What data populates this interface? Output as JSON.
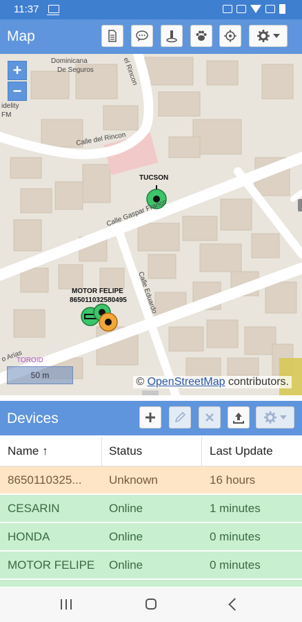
{
  "status_bar": {
    "time": "11:37"
  },
  "map_panel": {
    "title": "Map",
    "toolbar_icons": [
      "report-icon",
      "chat-icon",
      "geofence-icon",
      "paw-icon",
      "locate-icon",
      "gear-icon"
    ],
    "zoom_in": "+",
    "zoom_out": "−",
    "scale": "50 m",
    "attribution_link": "OpenStreetMap",
    "attribution_suffix": " contributors.",
    "attribution_prefix": "© ",
    "labels": {
      "dominicana": "Dominicana",
      "seguros": "De Seguros",
      "delrincon_v": "el Rincon",
      "idelity": "idelity",
      "fm": "FM",
      "calle_rincon": "Calle del Rincon",
      "calle_gaspar": "Calle Gaspar Franco",
      "calle_eduardo": "Calle Eduardo",
      "arias": "o Arias",
      "toroid": "TOROID"
    },
    "markers": {
      "tucson": "TUCSON",
      "motor_felipe": "MOTOR FELIPE",
      "imei_label": "865011032580495"
    },
    "marker_colors": {
      "online": "#3cc56a",
      "stale": "#f2a73b"
    }
  },
  "devices_panel": {
    "title": "Devices",
    "toolbar_icons": [
      "add-icon",
      "edit-icon",
      "delete-icon",
      "upload-icon",
      "gear-icon"
    ],
    "columns": {
      "name": "Name",
      "sort_indicator": "↑",
      "status": "Status",
      "last_update": "Last Update"
    },
    "rows": [
      {
        "name": "8650110325...",
        "status": "Unknown",
        "last_update": "16 hours"
      },
      {
        "name": "CESARIN",
        "status": "Online",
        "last_update": "1 minutes"
      },
      {
        "name": "HONDA",
        "status": "Online",
        "last_update": "0 minutes"
      },
      {
        "name": "MOTOR FELIPE",
        "status": "Online",
        "last_update": "0 minutes"
      }
    ]
  },
  "nav_bar": {
    "icons": [
      "recent-apps-icon",
      "home-icon",
      "back-icon"
    ]
  }
}
